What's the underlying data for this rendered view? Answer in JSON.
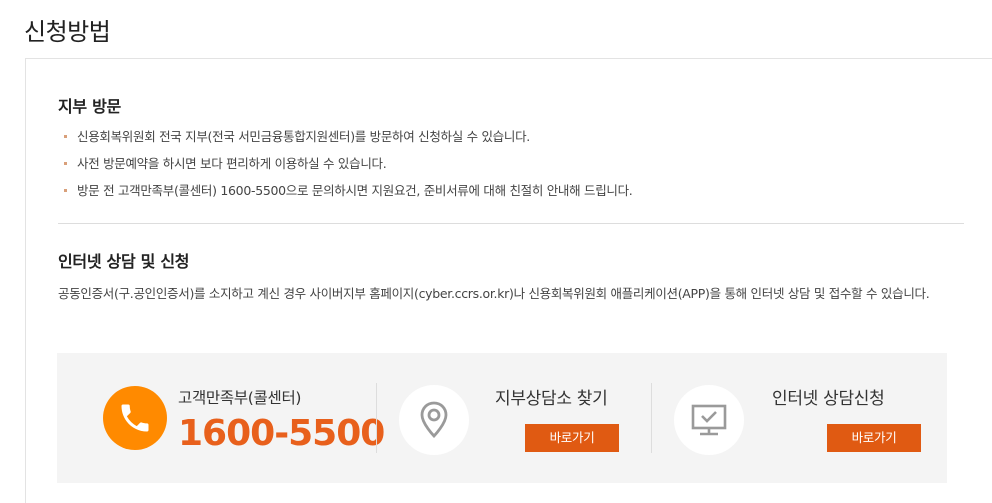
{
  "page": {
    "title": "신청방법"
  },
  "visit": {
    "title": "지부 방문",
    "items": [
      "신용회복위원회 전국 지부(전국 서민금융통합지원센터)를 방문하여 신청하실 수 있습니다.",
      "사전 방문예약을 하시면 보다 편리하게 이용하실 수 있습니다.",
      "방문 전 고객만족부(콜센터) 1600-5500으로 문의하시면 지원요건, 준비서류에 대해 친절히 안내해 드립니다."
    ]
  },
  "online": {
    "title": "인터넷 상담 및 신청",
    "description": "공동인증서(구.공인인증서)를 소지하고 계신 경우 사이버지부 홈페이지(cyber.ccrs.or.kr)나 신용회복위원회 애플리케이션(APP)을 통해 인터넷 상담 및 접수할 수 있습니다."
  },
  "contact": {
    "call": {
      "label": "고객만족부(콜센터)",
      "number": "1600-5500",
      "icon": "phone-icon"
    },
    "branch": {
      "title": "지부상담소 찾기",
      "button": "바로가기",
      "icon": "location-pin-icon"
    },
    "apply": {
      "title": "인터넷 상담신청",
      "button": "바로가기",
      "icon": "monitor-check-icon"
    }
  },
  "colors": {
    "accent": "#e8601c",
    "button": "#e05a12",
    "phone_circle": "#ff8a00",
    "box_background": "#f4f4f4",
    "icon_gray": "#9a9a9a"
  }
}
